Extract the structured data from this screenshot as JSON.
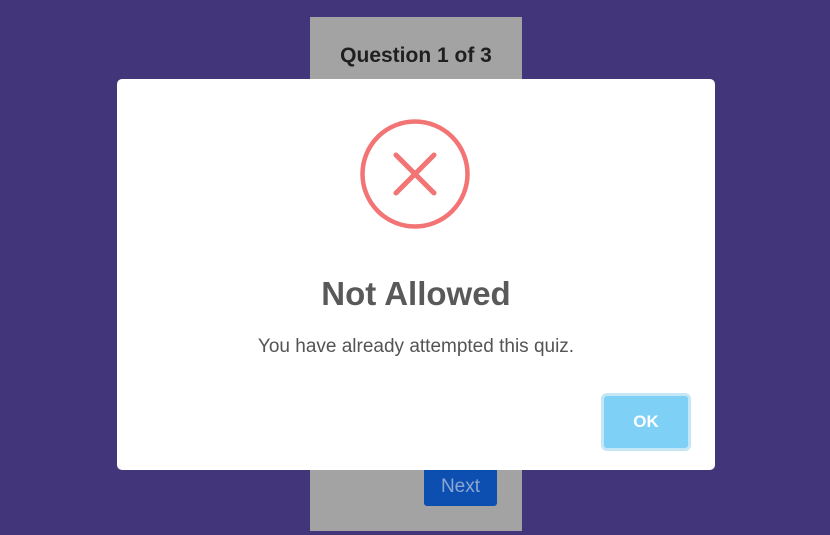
{
  "quiz": {
    "progress_label": "Question 1 of 3",
    "next_label": "Next"
  },
  "dialog": {
    "icon": "error-x-icon",
    "title": "Not Allowed",
    "message": "You have already attempted this quiz.",
    "ok_label": "OK"
  },
  "colors": {
    "background": "#42357a",
    "quiz_card": "#a3a3a3",
    "next_button": "#0d4fb0",
    "error_icon": "#f27474",
    "ok_button": "#7fd0f6"
  }
}
